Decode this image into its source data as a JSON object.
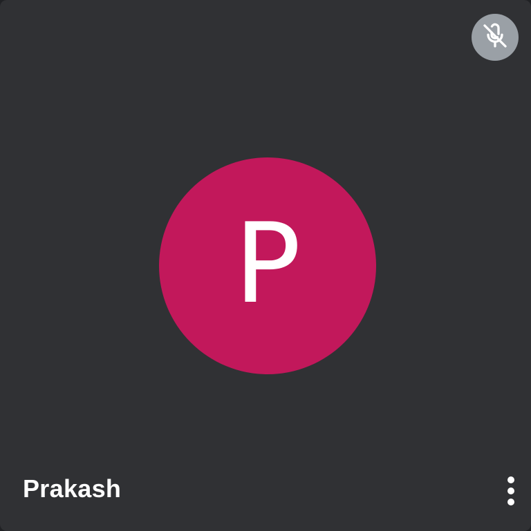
{
  "participant": {
    "name": "Prakash",
    "initial": "P",
    "avatar_color": "#c2185b",
    "mic_status": "muted"
  },
  "icons": {
    "mute": "mic-off-icon",
    "more": "more-vertical-icon"
  },
  "colors": {
    "tile_background": "#303134",
    "mute_badge": "#9aa0a6",
    "text": "#ffffff"
  }
}
